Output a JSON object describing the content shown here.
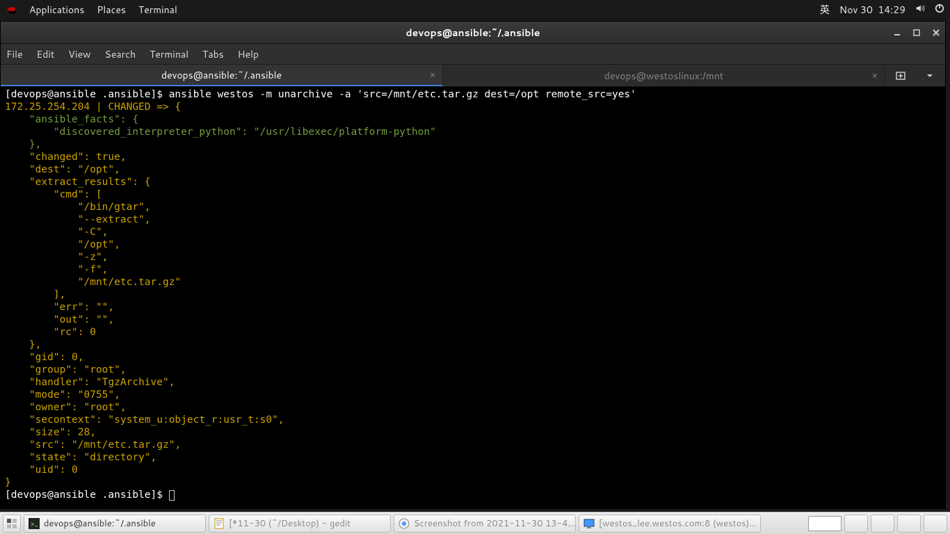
{
  "top_panel": {
    "apps": "Applications",
    "places": "Places",
    "terminal": "Terminal",
    "ime": "英",
    "date": "Nov 30",
    "time": "14:29"
  },
  "window": {
    "title": "devops@ansible:~/.ansible",
    "menu": {
      "file": "File",
      "edit": "Edit",
      "view": "View",
      "search": "Search",
      "terminal": "Terminal",
      "tabs": "Tabs",
      "help": "Help"
    },
    "tabs": [
      {
        "label": "devops@ansible:~/.ansible",
        "active": true
      },
      {
        "label": "devops@westoslinux:/mnt",
        "active": false
      }
    ]
  },
  "terminal": {
    "prompt1_pre": "[devops@ansible .ansible]$ ",
    "command": "ansible westos -m unarchive -a 'src=/mnt/etc.tar.gz dest=/opt remote_src=yes'",
    "status_line": "172.25.254.204 | CHANGED => {",
    "l1": "    \"ansible_facts\": {",
    "l2": "        \"discovered_interpreter_python\": \"/usr/libexec/platform-python\"",
    "l3": "    },",
    "l4": "    \"changed\": true,",
    "l5": "    \"dest\": \"/opt\",",
    "l6": "    \"extract_results\": {",
    "l7": "        \"cmd\": [",
    "l8": "            \"/bin/gtar\",",
    "l9": "            \"--extract\",",
    "l10": "            \"-C\",",
    "l11": "            \"/opt\",",
    "l12": "            \"-z\",",
    "l13": "            \"-f\",",
    "l14": "            \"/mnt/etc.tar.gz\"",
    "l15": "        ],",
    "l16": "        \"err\": \"\",",
    "l17": "        \"out\": \"\",",
    "l18": "        \"rc\": 0",
    "l19": "    },",
    "l20": "    \"gid\": 0,",
    "l21": "    \"group\": \"root\",",
    "l22": "    \"handler\": \"TgzArchive\",",
    "l23": "    \"mode\": \"0755\",",
    "l24": "    \"owner\": \"root\",",
    "l25": "    \"secontext\": \"system_u:object_r:usr_t:s0\",",
    "l26": "    \"size\": 28,",
    "l27": "    \"src\": \"/mnt/etc.tar.gz\",",
    "l28": "    \"state\": \"directory\",",
    "l29": "    \"uid\": 0",
    "l30": "}",
    "prompt2": "[devops@ansible .ansible]$ "
  },
  "taskbar": {
    "t1": "devops@ansible:~/.ansible",
    "t2": "[*11-30 (~/Desktop) - gedit",
    "t3": "Screenshot from 2021-11-30 13-4…",
    "t4": "[westos_lee.westos.com:8 (westos)…"
  }
}
